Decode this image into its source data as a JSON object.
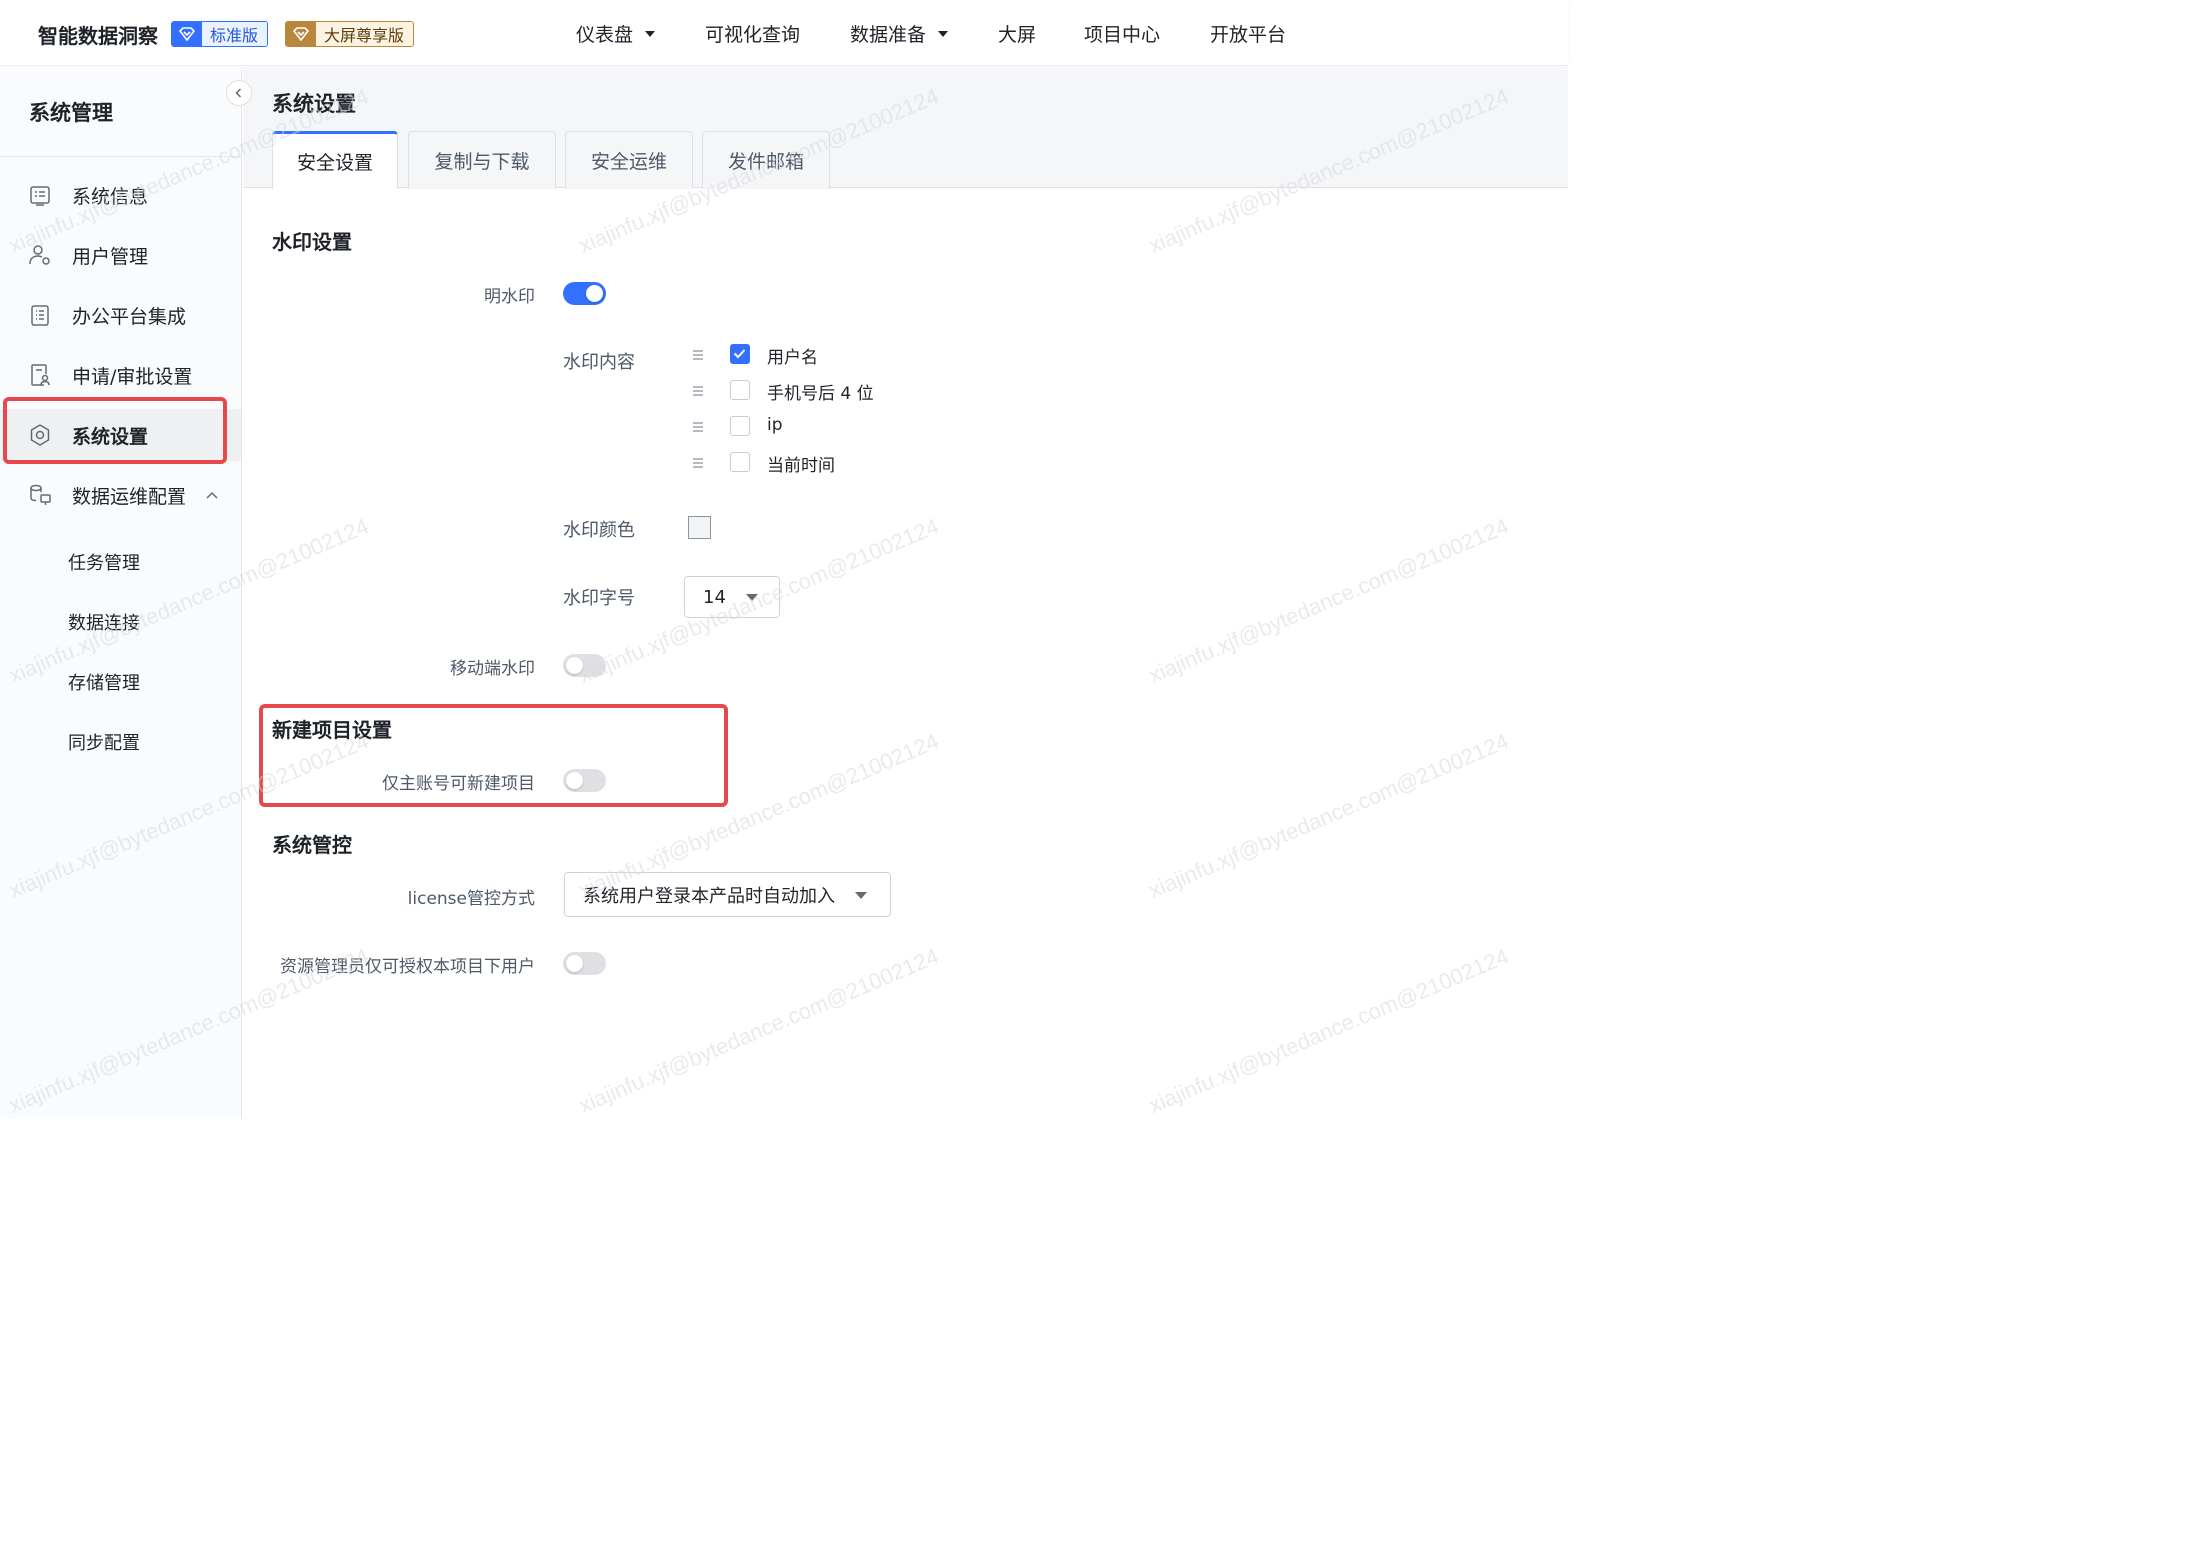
{
  "header": {
    "app_title": "智能数据洞察",
    "badge_standard": "标准版",
    "badge_vip": "大屏尊享版",
    "nav": [
      {
        "label": "仪表盘",
        "dropdown": true
      },
      {
        "label": "可视化查询",
        "dropdown": false
      },
      {
        "label": "数据准备",
        "dropdown": true
      },
      {
        "label": "大屏",
        "dropdown": false
      },
      {
        "label": "项目中心",
        "dropdown": false
      },
      {
        "label": "开放平台",
        "dropdown": false
      }
    ]
  },
  "sidebar": {
    "title": "系统管理",
    "items": [
      {
        "label": "系统信息",
        "icon": "info-card-icon"
      },
      {
        "label": "用户管理",
        "icon": "user-gear-icon"
      },
      {
        "label": "办公平台集成",
        "icon": "document-list-icon"
      },
      {
        "label": "申请/审批设置",
        "icon": "approval-icon"
      },
      {
        "label": "系统设置",
        "icon": "gear-icon",
        "active": true
      },
      {
        "label": "数据运维配置",
        "icon": "data-ops-icon",
        "expanded": true
      }
    ],
    "sub_items": [
      "任务管理",
      "数据连接",
      "存储管理",
      "同步配置"
    ]
  },
  "main": {
    "page_title": "系统设置",
    "tabs": [
      {
        "label": "安全设置",
        "active": true
      },
      {
        "label": "复制与下载",
        "active": false
      },
      {
        "label": "安全运维",
        "active": false
      },
      {
        "label": "发件邮箱",
        "active": false
      }
    ],
    "watermark_section": {
      "title": "水印设置",
      "visible_watermark_label": "明水印",
      "visible_watermark_on": true,
      "content_label": "水印内容",
      "content_options": [
        {
          "label": "用户名",
          "checked": true
        },
        {
          "label": "手机号后 4 位",
          "checked": false
        },
        {
          "label": "ip",
          "checked": false
        },
        {
          "label": "当前时间",
          "checked": false
        }
      ],
      "color_label": "水印颜色",
      "color_value": "#f2f3f5",
      "font_size_label": "水印字号",
      "font_size_value": "14",
      "mobile_label": "移动端水印",
      "mobile_on": false
    },
    "new_project_section": {
      "title": "新建项目设置",
      "owner_only_label": "仅主账号可新建项目",
      "owner_only_on": false
    },
    "system_control_section": {
      "title": "系统管控",
      "license_label": "license管控方式",
      "license_value": "系统用户登录本产品时自动加入",
      "resource_admin_label": "资源管理员仅可授权本项目下用户",
      "resource_admin_on": false
    }
  },
  "watermark_text": "xiajinfu.xjf@bytedance.com@21002124",
  "colors": {
    "primary": "#3370ff",
    "highlight": "#e5484d",
    "vip_gold": "#b8873c"
  }
}
